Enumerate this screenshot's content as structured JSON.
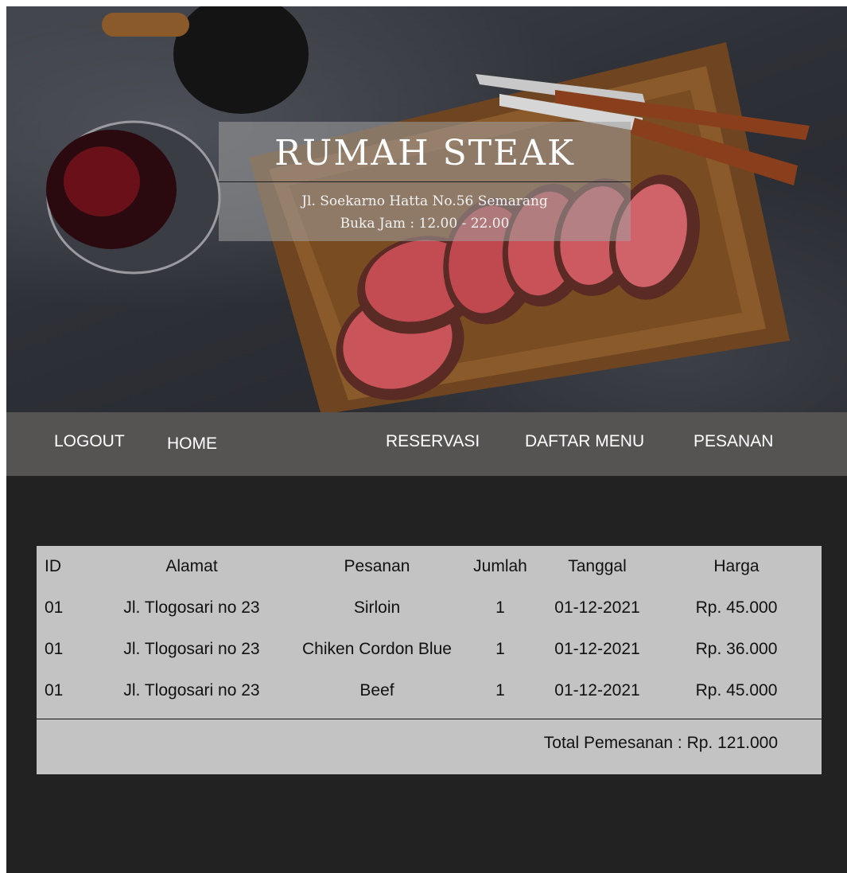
{
  "hero": {
    "title": "RUMAH STEAK",
    "address": "Jl. Soekarno Hatta No.56 Semarang",
    "hours": "Buka Jam : 12.00 - 22.00"
  },
  "nav": {
    "logout": "LOGOUT",
    "home": "HOME",
    "reservasi": "RESERVASI",
    "daftar_menu": "DAFTAR MENU",
    "pesanan": "PESANAN"
  },
  "table": {
    "headers": {
      "id": "ID",
      "alamat": "Alamat",
      "pesanan": "Pesanan",
      "jumlah": "Jumlah",
      "tanggal": "Tanggal",
      "harga": "Harga"
    },
    "rows": [
      {
        "id": "01",
        "alamat": "Jl. Tlogosari no 23",
        "pesanan": "Sirloin",
        "jumlah": "1",
        "tanggal": "01-12-2021",
        "harga": "Rp. 45.000"
      },
      {
        "id": "01",
        "alamat": "Jl. Tlogosari no 23",
        "pesanan": "Chiken Cordon Blue",
        "jumlah": "1",
        "tanggal": "01-12-2021",
        "harga": "Rp. 36.000"
      },
      {
        "id": "01",
        "alamat": "Jl. Tlogosari no 23",
        "pesanan": "Beef",
        "jumlah": "1",
        "tanggal": "01-12-2021",
        "harga": "Rp. 45.000"
      }
    ],
    "total": "Total Pemesanan : Rp. 121.000"
  },
  "colors": {
    "page_background": "#232223",
    "nav_background": "#565353",
    "table_background": "#c3c3c3",
    "title_box": "#a0a0a0"
  }
}
